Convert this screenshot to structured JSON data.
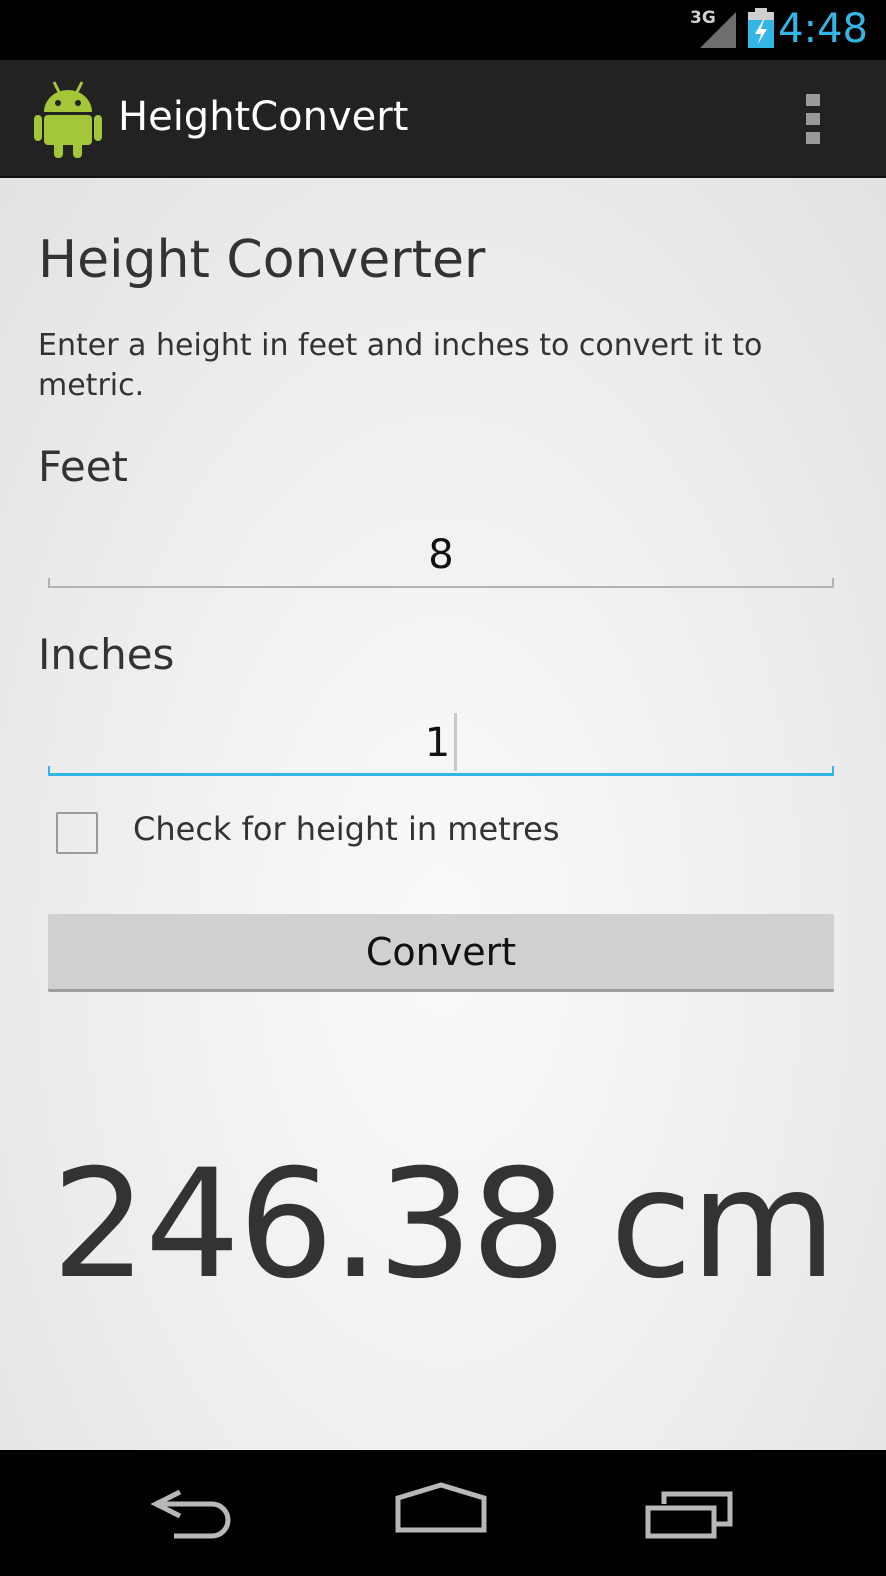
{
  "status_bar": {
    "network": "3G",
    "clock": "4:48",
    "signal_icon": "signal-icon",
    "battery_icon": "battery-charging-icon",
    "accent_color": "#33b5e5"
  },
  "action_bar": {
    "app_icon": "android-icon",
    "title": "HeightConvert",
    "overflow_icon": "overflow-menu-icon"
  },
  "main": {
    "heading": "Height Converter",
    "description": "Enter a height in feet and inches to convert it to metric.",
    "feet": {
      "label": "Feet",
      "value": "8"
    },
    "inches": {
      "label": "Inches",
      "value": "1"
    },
    "metres_checkbox": {
      "label": "Check for height in metres",
      "checked": false
    },
    "convert_button": "Convert",
    "result": "246.38 cm"
  },
  "nav_bar": {
    "back_icon": "back-icon",
    "home_icon": "home-icon",
    "recents_icon": "recents-icon"
  }
}
